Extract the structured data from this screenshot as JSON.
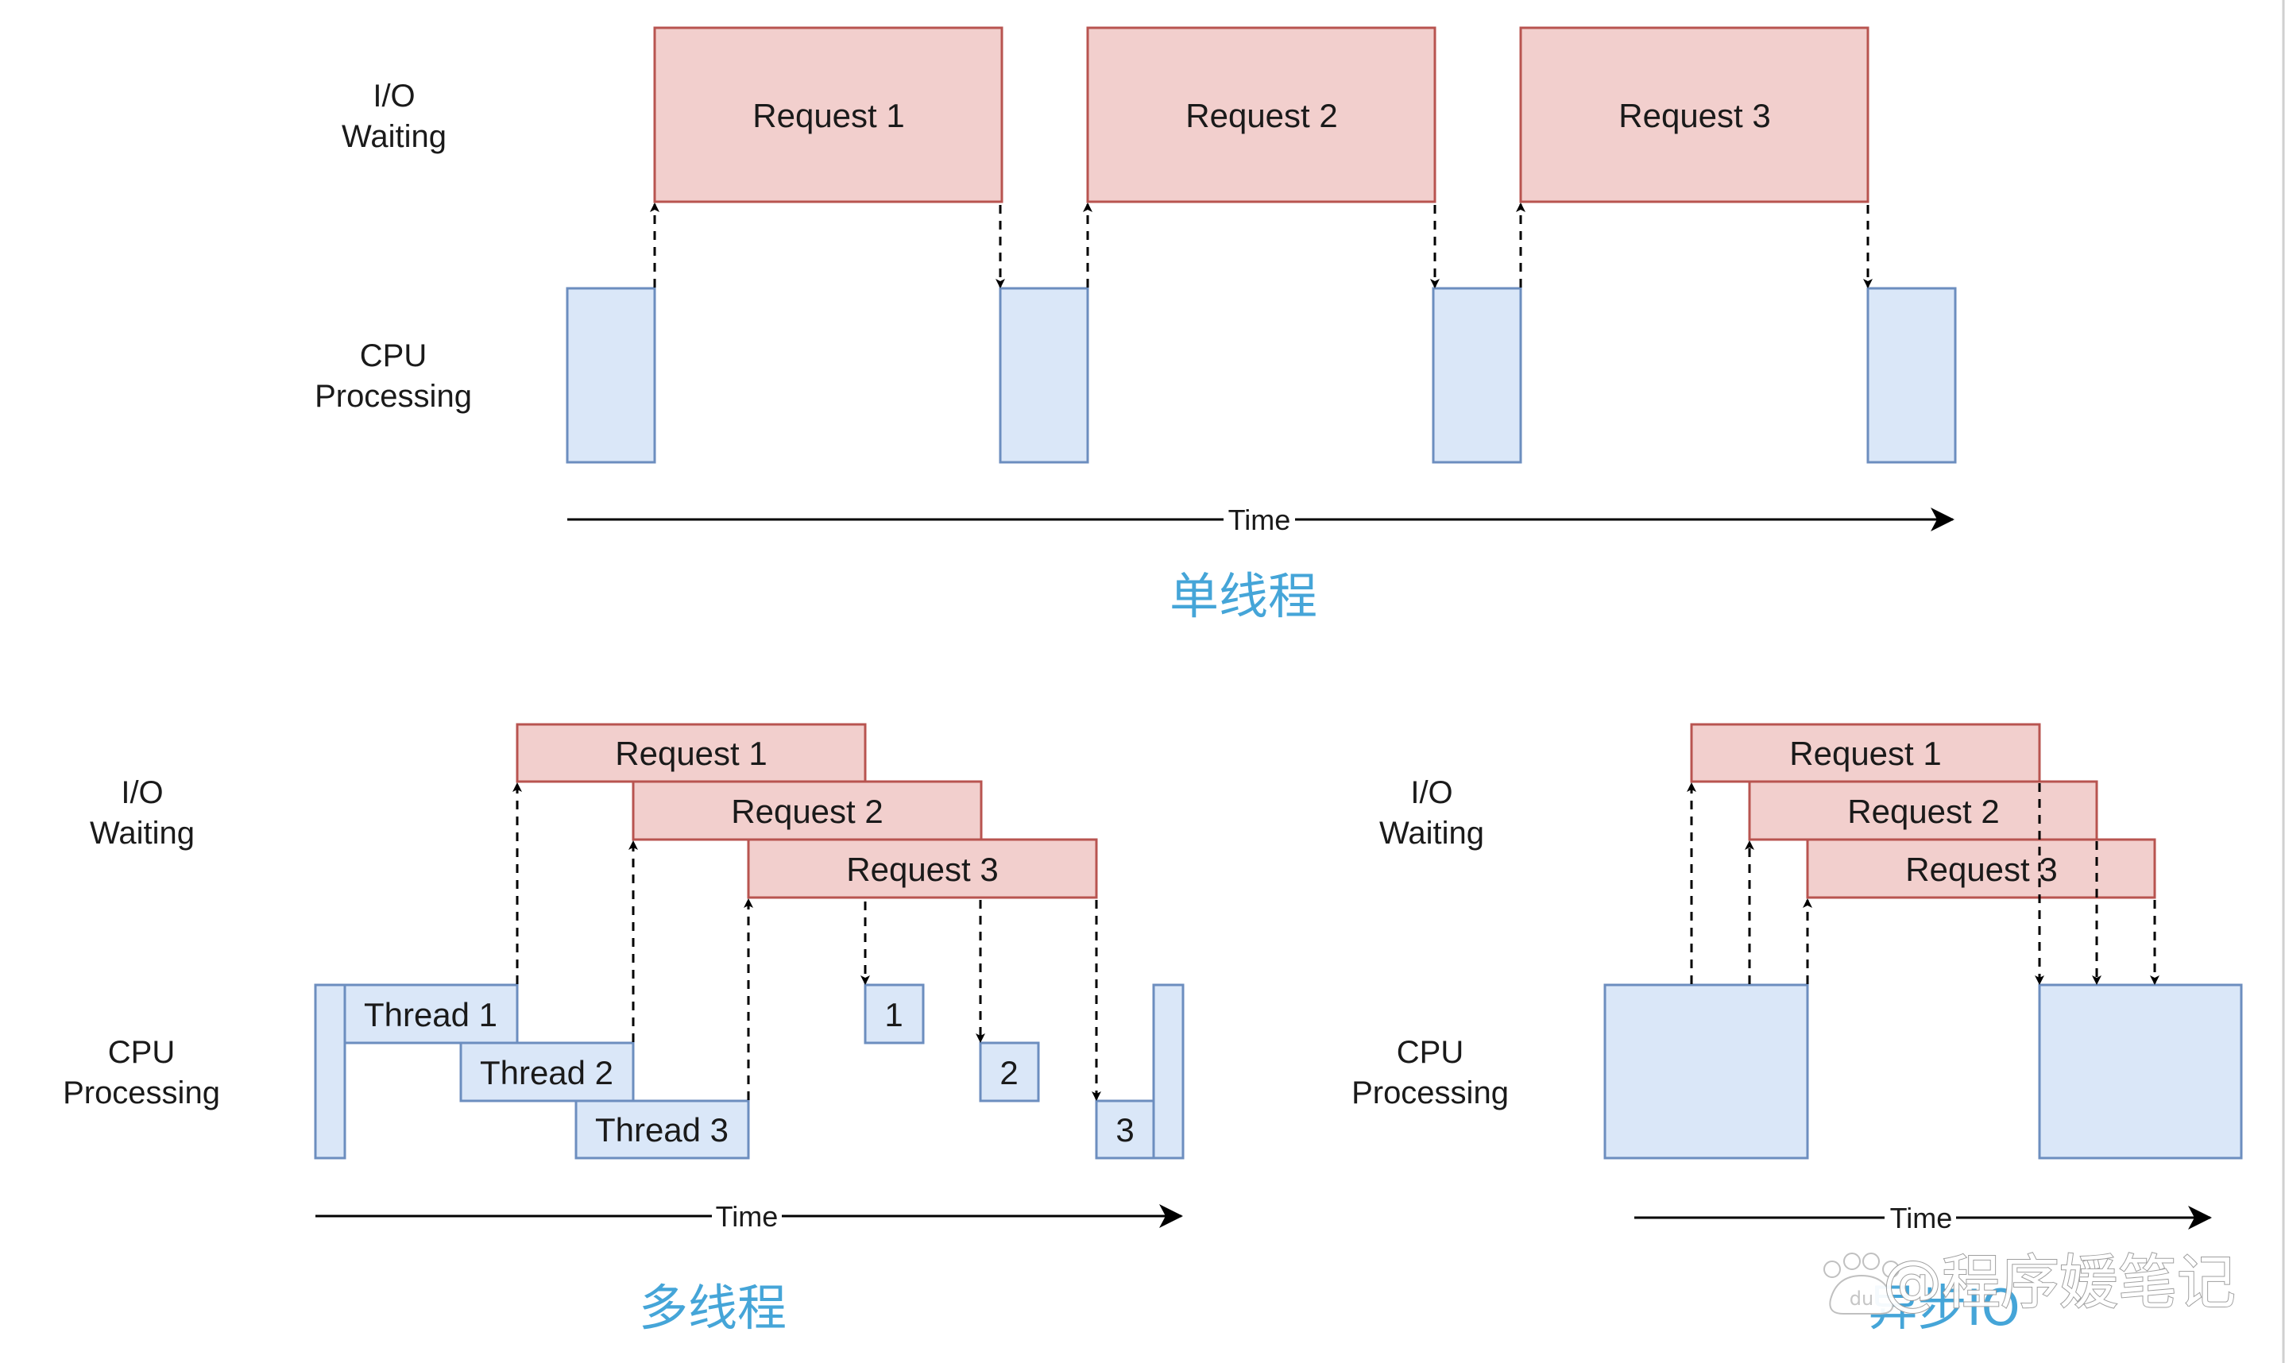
{
  "colors": {
    "request_fill": "#f2cfcd",
    "request_stroke": "#b85450",
    "cpu_fill": "#dae7f8",
    "cpu_stroke": "#6c8ebf",
    "caption": "#45a5d8",
    "text": "#1a1a1a"
  },
  "panels": {
    "single_thread": {
      "row_labels": {
        "io_line1": "I/O",
        "io_line2": "Waiting",
        "cpu_line1": "CPU",
        "cpu_line2": "Processing"
      },
      "requests": [
        "Request 1",
        "Request 2",
        "Request 3"
      ],
      "cpu_blocks": 4,
      "axis_label": "Time",
      "caption": "单线程"
    },
    "multi_thread": {
      "row_labels": {
        "io_line1": "I/O",
        "io_line2": "Waiting",
        "cpu_line1": "CPU",
        "cpu_line2": "Processing"
      },
      "requests": [
        "Request 1",
        "Request 2",
        "Request 3"
      ],
      "threads": [
        "Thread 1",
        "Thread 2",
        "Thread 3"
      ],
      "callbacks": [
        "1",
        "2",
        "3"
      ],
      "axis_label": "Time",
      "caption": "多线程"
    },
    "async_io": {
      "row_labels": {
        "io_line1": "I/O",
        "io_line2": "Waiting",
        "cpu_line1": "CPU",
        "cpu_line2": "Processing"
      },
      "requests": [
        "Request 1",
        "Request 2",
        "Request 3"
      ],
      "cpu_blocks": 2,
      "axis_label": "Time",
      "caption": "异步IO"
    }
  },
  "watermark": {
    "logo_text": "du",
    "text": "@程序媛笔记"
  }
}
